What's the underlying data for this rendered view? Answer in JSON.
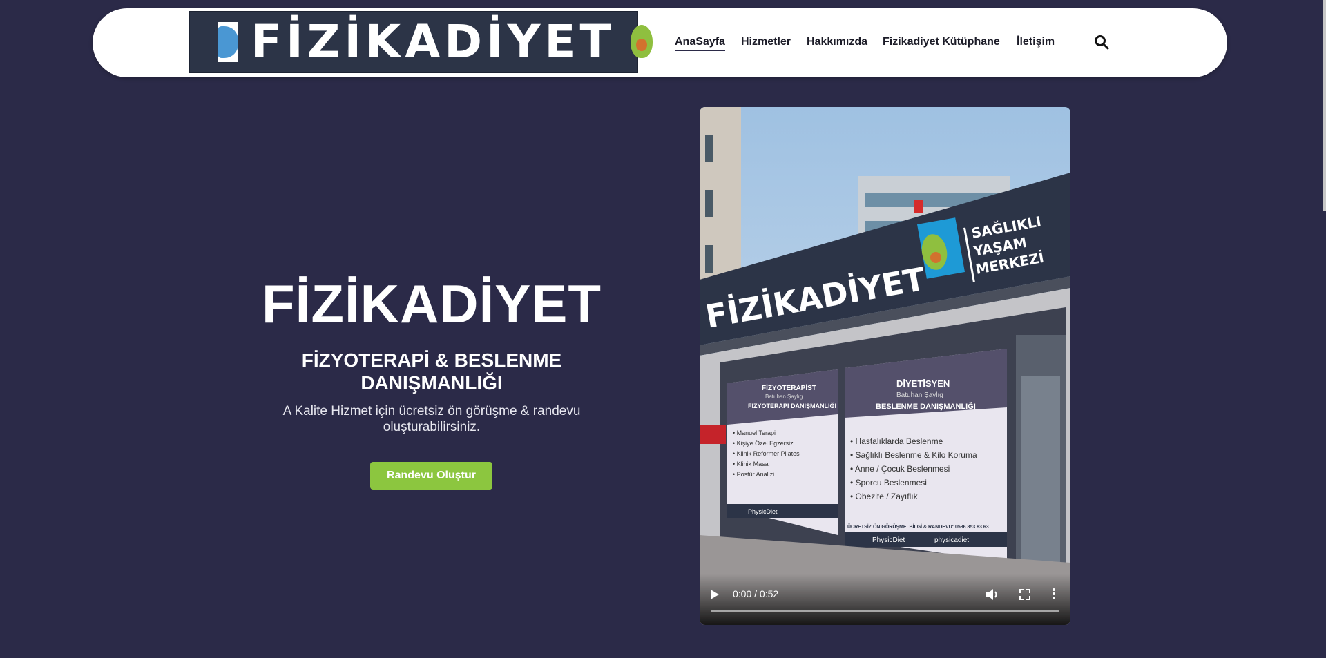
{
  "header": {
    "logo": {
      "wordmark": "FİZİKADİYET",
      "tagline": [
        "SAĞLIKLI",
        "YAŞAM",
        "MERKEZİ"
      ]
    },
    "nav": [
      {
        "label": "AnaSayfa",
        "active": true
      },
      {
        "label": "Hizmetler",
        "active": false
      },
      {
        "label": "Hakkımızda",
        "active": false
      },
      {
        "label": "Fizikadiyet Kütüphane",
        "active": false
      },
      {
        "label": "İletişim",
        "active": false
      }
    ],
    "search_icon": "search-icon"
  },
  "hero": {
    "title": "FİZİKADİYET",
    "subtitle": "FİZYOTERAPİ & BESLENME DANIŞMANLIĞI",
    "description": "A Kalite Hizmet için ücretsiz ön görüşme & randevu oluşturabilirsiniz.",
    "cta_label": "Randevu Oluştur"
  },
  "video": {
    "time": "0:00 / 0:52",
    "progress": 0,
    "controls": [
      "play-icon",
      "volume-icon",
      "fullscreen-icon",
      "more-options-icon"
    ],
    "scene_text": {
      "sign_brand": "FİZİKADİYET",
      "sign_tagline": [
        "SAĞLIKLI",
        "YAŞAM",
        "MERKEZİ"
      ],
      "left_panel_title": "FİZYOTERAPİST",
      "left_panel_name": "Batuhan Şaylıg",
      "left_panel_sub": "FİZYOTERAPİ DANIŞMANLIĞI",
      "left_panel_items": [
        "• Manuel Terapi",
        "• Kişiye Özel Egzersiz",
        "• Klinik Reformer Pilates",
        "• Klinik Masaj",
        "• Postür Analizi"
      ],
      "right_panel_title": "DİYETİSYEN",
      "right_panel_name": "Batuhan Şaylıg",
      "right_panel_sub": "BESLENME DANIŞMANLIĞI",
      "right_panel_items": [
        "• Hastalıklarda Beslenme",
        "• Sağlıklı Beslenme & Kilo Koruma",
        "• Anne / Çocuk Beslenmesi",
        "• Sporcu Beslenmesi",
        "• Obezite / Zayıflık"
      ],
      "phone_line": "ÜCRETSİZ ÖN GÖRÜŞME, BİLGİ & RANDEVU: 0536 853 83 63",
      "footer_left": "PhysicDiet",
      "footer_right": "physicadiet"
    }
  },
  "colors": {
    "background": "#2b2a48",
    "cta": "#8cc63f",
    "logo_bg": "#2c3447"
  }
}
